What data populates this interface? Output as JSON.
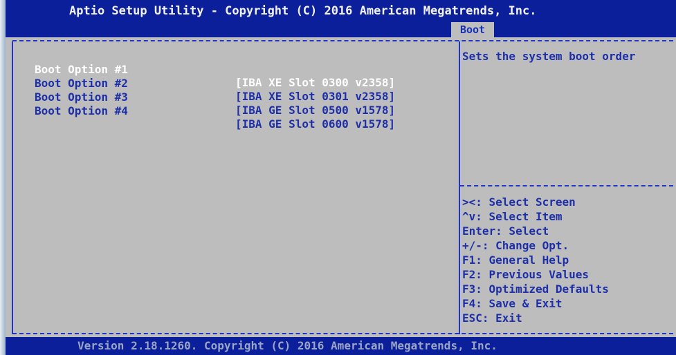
{
  "header": {
    "title": "Aptio Setup Utility - Copyright (C) 2016 American Megatrends, Inc.",
    "active_tab": "Boot"
  },
  "boot_options": [
    {
      "label": "Boot Option #1",
      "value": "[IBA XE Slot 0300 v2358]",
      "selected": true
    },
    {
      "label": "Boot Option #2",
      "value": "[IBA XE Slot 0301 v2358]",
      "selected": false
    },
    {
      "label": "Boot Option #3",
      "value": "[IBA GE Slot 0500 v1578]",
      "selected": false
    },
    {
      "label": "Boot Option #4",
      "value": "[IBA GE Slot 0600 v1578]",
      "selected": false
    }
  ],
  "help": {
    "text": "Sets the system boot order"
  },
  "keys": [
    "><: Select Screen",
    "^v: Select Item",
    "Enter: Select",
    "+/-: Change Opt.",
    "F1: General Help",
    "F2: Previous Values",
    "F3: Optimized Defaults",
    "F4: Save & Exit",
    "ESC: Exit"
  ],
  "footer": {
    "text": "Version 2.18.1260. Copyright (C) 2016 American Megatrends, Inc."
  },
  "colors": {
    "title_bar": "#0c1f9a",
    "body_bg": "#bdbdbd",
    "text": "#1d2fa8",
    "selected_text": "#ffffff"
  }
}
